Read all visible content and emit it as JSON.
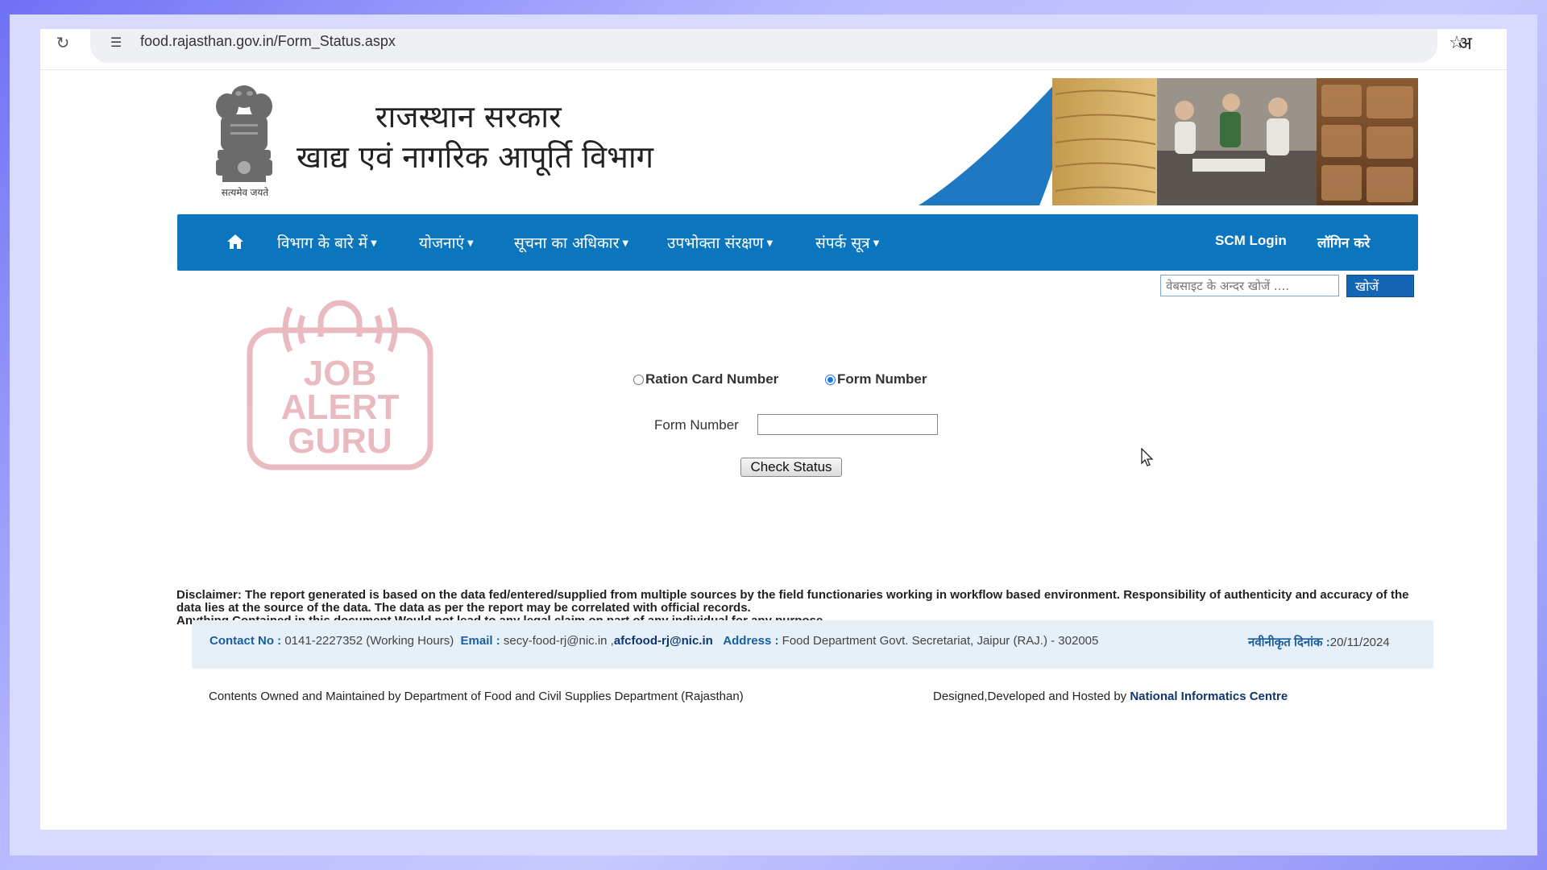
{
  "browser": {
    "url": "food.rajasthan.gov.in/Form_Status.aspx",
    "translate_glyph": "अ"
  },
  "header": {
    "emblem_motto": "सत्यमेव जयते",
    "title_line1": "राजस्थान सरकार",
    "title_line2": "खाद्य एवं नागरिक आपूर्ति विभाग"
  },
  "nav": {
    "items": [
      {
        "label": "विभाग के बारे में"
      },
      {
        "label": "योजनाएं"
      },
      {
        "label": "सूचना का अधिकार"
      },
      {
        "label": "उपभोक्ता संरक्षण"
      },
      {
        "label": "संपर्क सूत्र"
      }
    ],
    "scm_login": "SCM Login",
    "login": "लॉगिन करे"
  },
  "search": {
    "placeholder": "वेबसाइट के अन्दर खोजें ....",
    "button": "खोजें"
  },
  "watermark": {
    "line1": "JOB",
    "line2": "ALERT",
    "line3": "GURU"
  },
  "form": {
    "radio_ration": "Ration Card Number",
    "radio_form": "Form Number",
    "selected": "Form Number",
    "field_label": "Form Number",
    "field_value": "",
    "submit": "Check Status"
  },
  "disclaimer": {
    "line1": "Disclaimer: The report generated is based on the data fed/entered/supplied from multiple sources by the field functionaries working in workflow based environment. Responsibility of authenticity and accuracy of the data lies at the source of the data. The data as per the report may be correlated with official records.",
    "line2": "Anything Contained in this document Would not lead to any legal claim on part of any individual for any purpose."
  },
  "contact": {
    "contact_label": "Contact No :",
    "contact_value": "0141-2227352 (Working Hours)",
    "email_label": "Email :",
    "email1": "secy-food-rj@nic.in ,",
    "email2": "afcfood-rj@nic.in",
    "address_label": "Address :",
    "address_value": "Food Department Govt. Secretariat, Jaipur (RAJ.) - 302005",
    "updated_label": "नवीनीकृत दिनांक :",
    "updated_value": "20/11/2024"
  },
  "footer": {
    "left": "Contents Owned and Maintained by Department of Food and Civil Supplies Department (Rajasthan)",
    "right_prefix": "Designed,Developed and Hosted by",
    "right_link": "National Informatics Centre"
  },
  "colors": {
    "nav_blue": "#0b75bd",
    "search_button": "#1466b5",
    "watermark_red": "#e4a4ad"
  }
}
